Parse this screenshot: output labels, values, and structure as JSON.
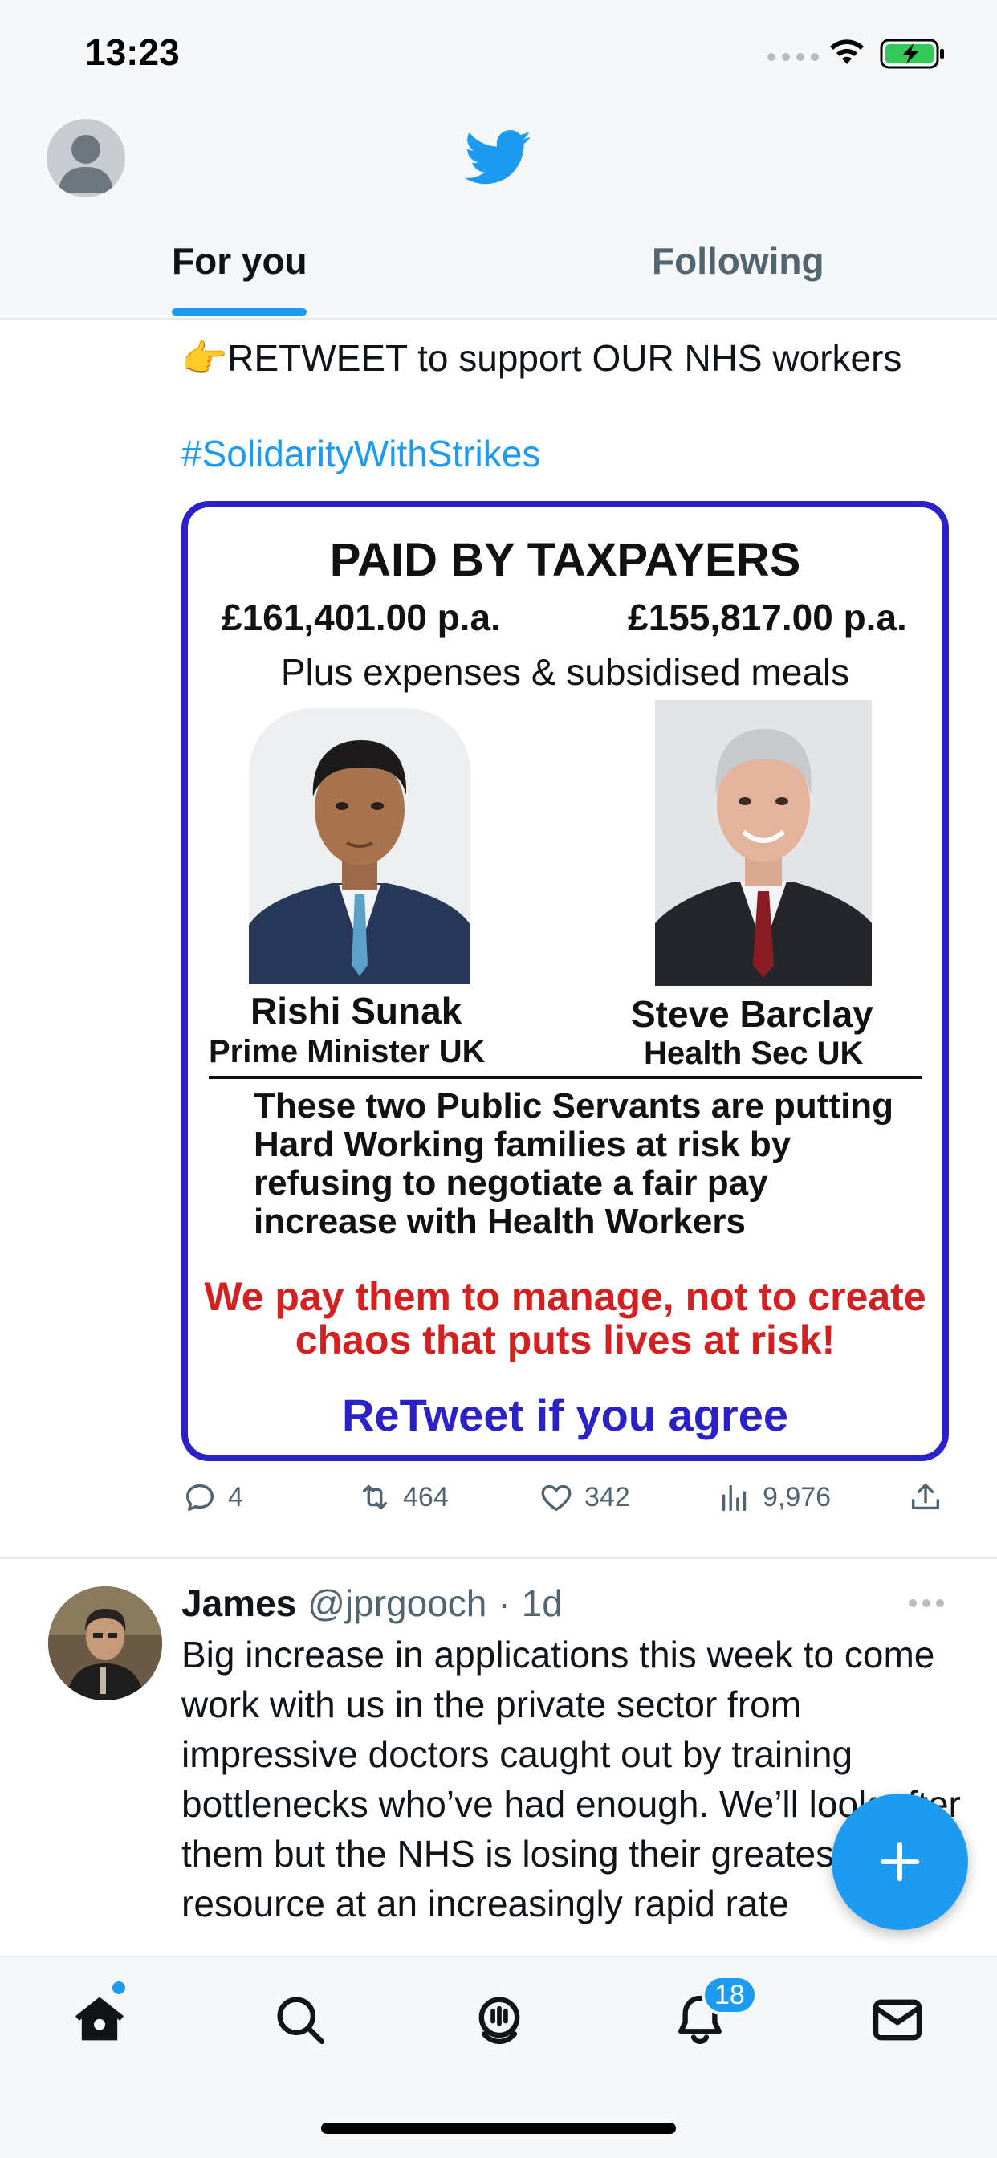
{
  "status_bar": {
    "time": "13:23"
  },
  "header": {
    "tabs": [
      {
        "label": "For you",
        "active": true
      },
      {
        "label": "Following",
        "active": false
      }
    ]
  },
  "tweet1": {
    "text": "👉RETWEET to support OUR NHS workers",
    "hashtag": "#SolidarityWithStrikes",
    "image": {
      "title": "PAID BY TAXPAYERS",
      "salary_left": "£161,401.00 p.a.",
      "salary_right": "£155,817.00 p.a.",
      "extras": "Plus expenses & subsidised meals",
      "person_left_name": "Rishi Sunak",
      "person_left_role": "Prime Minister UK",
      "person_right_name": "Steve Barclay",
      "person_right_role": "Health Sec UK",
      "body": "These two Public Servants are putting Hard Working families at risk by refusing to negotiate a fair pay increase with Health Workers",
      "red_text": "We pay them to manage, not to create chaos that puts lives at risk!",
      "cta": "ReTweet if you agree"
    },
    "actions": {
      "replies": "4",
      "retweets": "464",
      "likes": "342",
      "views": "9,976"
    }
  },
  "tweet2": {
    "name": "James",
    "handle": "@jprgooch",
    "separator": "·",
    "time": "1d",
    "text": "Big increase in applications this week to come work with us in the private sector from impressive doctors caught out by training bottlenecks who’ve had enough. We’ll look after them but the NHS is losing their greatest resource at an increasingly rapid rate"
  },
  "bottom_nav": {
    "notifications_badge": "18"
  },
  "colors": {
    "accent": "#1d9bf0",
    "poster_border": "#2a21c7",
    "poster_red": "#d32020",
    "muted": "#536471"
  }
}
